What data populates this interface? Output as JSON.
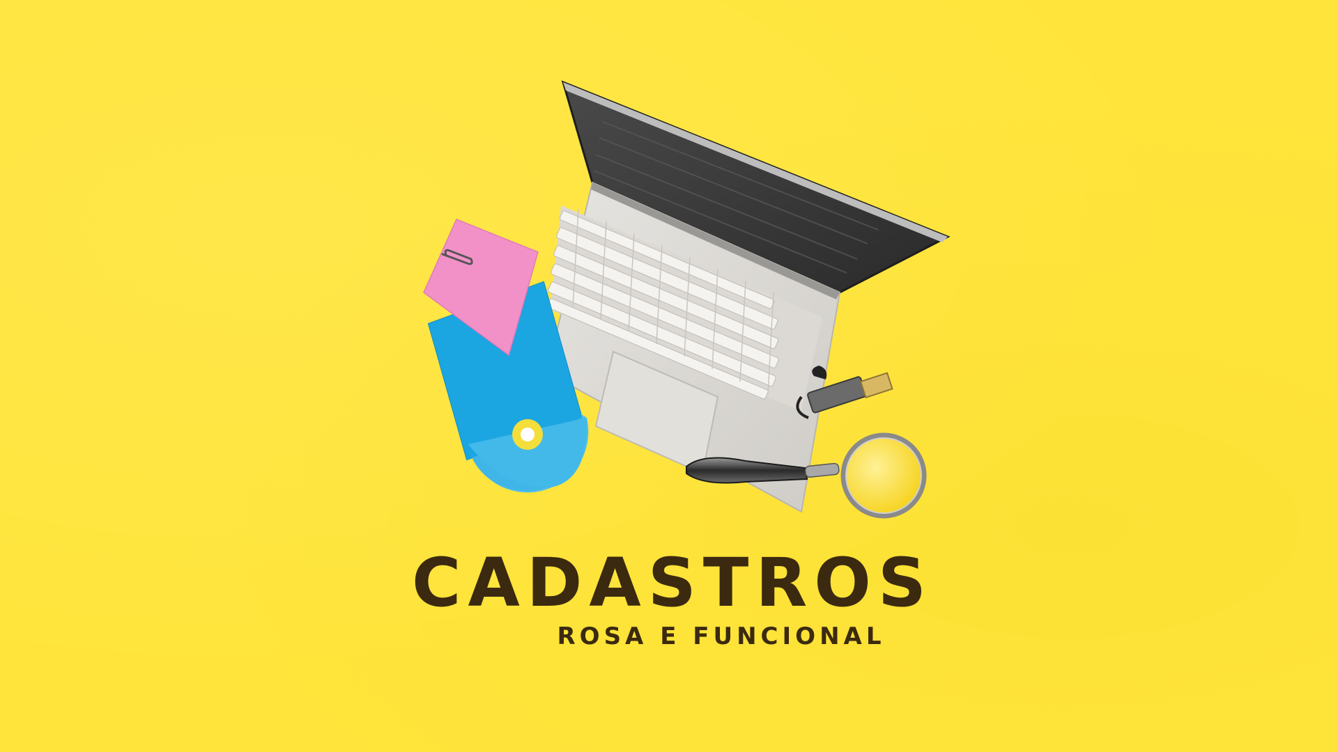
{
  "title": {
    "main": "CADASTROS",
    "subtitle": "ROSA E FUNCIONAL"
  },
  "colors": {
    "background": "#FFE53B",
    "title_text": "#3B2A10",
    "sticky_note": "#F291C8",
    "cd_sleeve": "#1BA6E2",
    "laptop_body": "#D8D6D2"
  },
  "objects": [
    "laptop-icon",
    "sticky-note-icon",
    "paper-clip-icon",
    "cd-sleeve-icon",
    "cd-disc-icon",
    "usb-drive-icon",
    "magnifying-glass-icon"
  ]
}
